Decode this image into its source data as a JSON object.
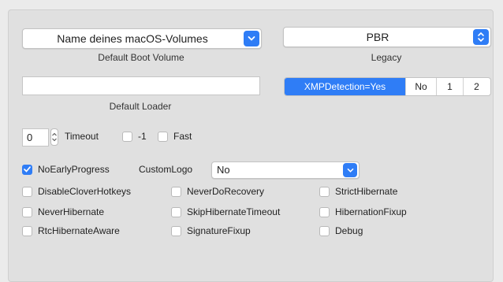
{
  "boot": {
    "volume_value": "Name deines macOS-Volumes",
    "volume_caption": "Default Boot Volume",
    "legacy_value": "PBR",
    "legacy_caption": "Legacy",
    "loader_value": "",
    "loader_caption": "Default Loader"
  },
  "xmp": {
    "segments": [
      "XMPDetection=Yes",
      "No",
      "1",
      "2"
    ],
    "selected": "XMPDetection=Yes"
  },
  "timeout": {
    "value": "0",
    "label": "Timeout",
    "minus_one_label": "-1",
    "fast_label": "Fast",
    "minus_one_checked": false,
    "fast_checked": false
  },
  "logo": {
    "no_early_progress_label": "NoEarlyProgress",
    "no_early_progress_checked": true,
    "custom_logo_label": "CustomLogo",
    "custom_logo_value": "No"
  },
  "flags": {
    "disable_clover_hotkeys": {
      "label": "DisableCloverHotkeys",
      "checked": false
    },
    "never_do_recovery": {
      "label": "NeverDoRecovery",
      "checked": false
    },
    "strict_hibernate": {
      "label": "StrictHibernate",
      "checked": false
    },
    "never_hibernate": {
      "label": "NeverHibernate",
      "checked": false
    },
    "skip_hibernate_timeout": {
      "label": "SkipHibernateTimeout",
      "checked": false
    },
    "hibernation_fixup": {
      "label": "HibernationFixup",
      "checked": false
    },
    "rtc_hibernate_aware": {
      "label": "RtcHibernateAware",
      "checked": false
    },
    "signature_fixup": {
      "label": "SignatureFixup",
      "checked": false
    },
    "debug": {
      "label": "Debug",
      "checked": false
    }
  },
  "colors": {
    "accent": "#2f7df6",
    "panel": "#e0e0e0"
  },
  "icons": {
    "popup": "chevron-down-icon",
    "select": "chevron-updown-icon",
    "check": "checkmark-icon"
  }
}
